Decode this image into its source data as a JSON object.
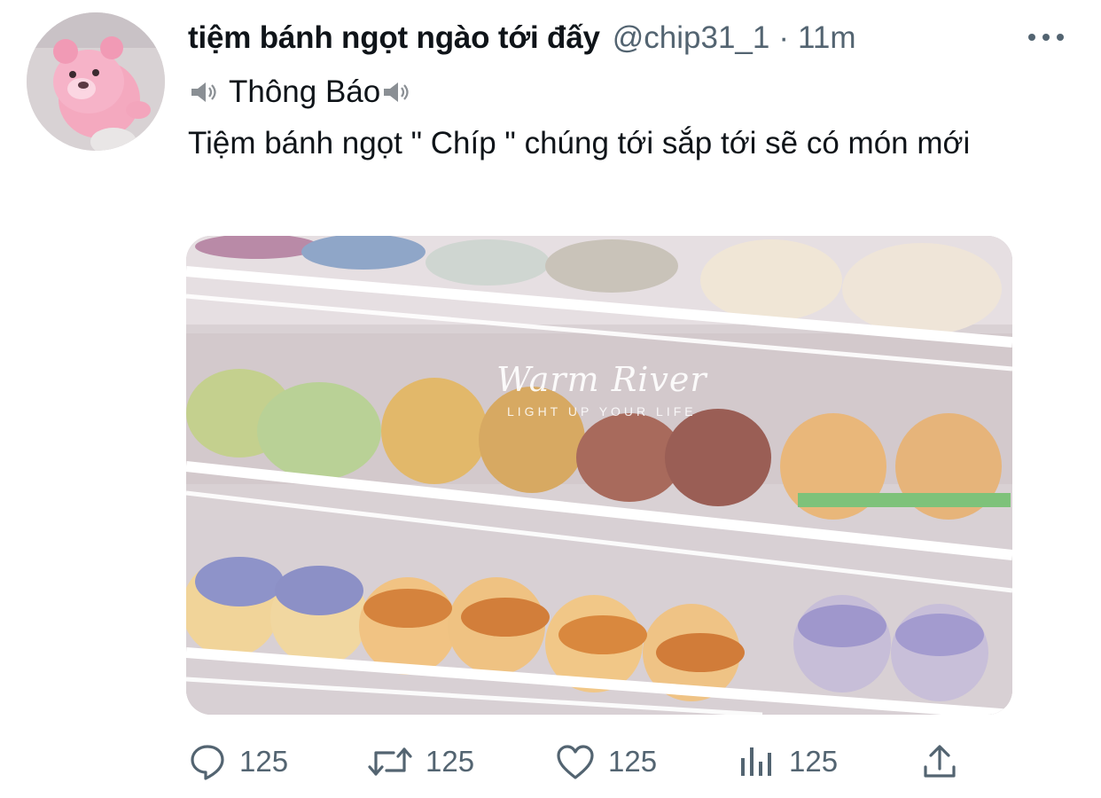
{
  "tweet": {
    "display_name": "tiệm bánh ngọt ngào tới đấy",
    "handle": "@chip31_1",
    "separator": "·",
    "time": "11m",
    "line1": "Thông Báo",
    "line2": "Tiệm bánh ngọt \" Chíp \" chúng tới sắp tới sẽ có món mới",
    "line1_icons": [
      "speaker-icon",
      "speaker-icon"
    ]
  },
  "media": {
    "watermark_title": "Warm River",
    "watermark_subtitle": "LIGHT UP YOUR LIFE"
  },
  "actions": {
    "reply_count": "125",
    "retweet_count": "125",
    "like_count": "125",
    "views_count": "125"
  },
  "icons": {
    "reply": "reply-icon",
    "retweet": "retweet-icon",
    "like": "heart-icon",
    "views": "views-icon",
    "share": "share-icon",
    "more": "more-icon"
  },
  "colors": {
    "text": "#0f1419",
    "secondary": "#536471",
    "background": "#ffffff"
  }
}
